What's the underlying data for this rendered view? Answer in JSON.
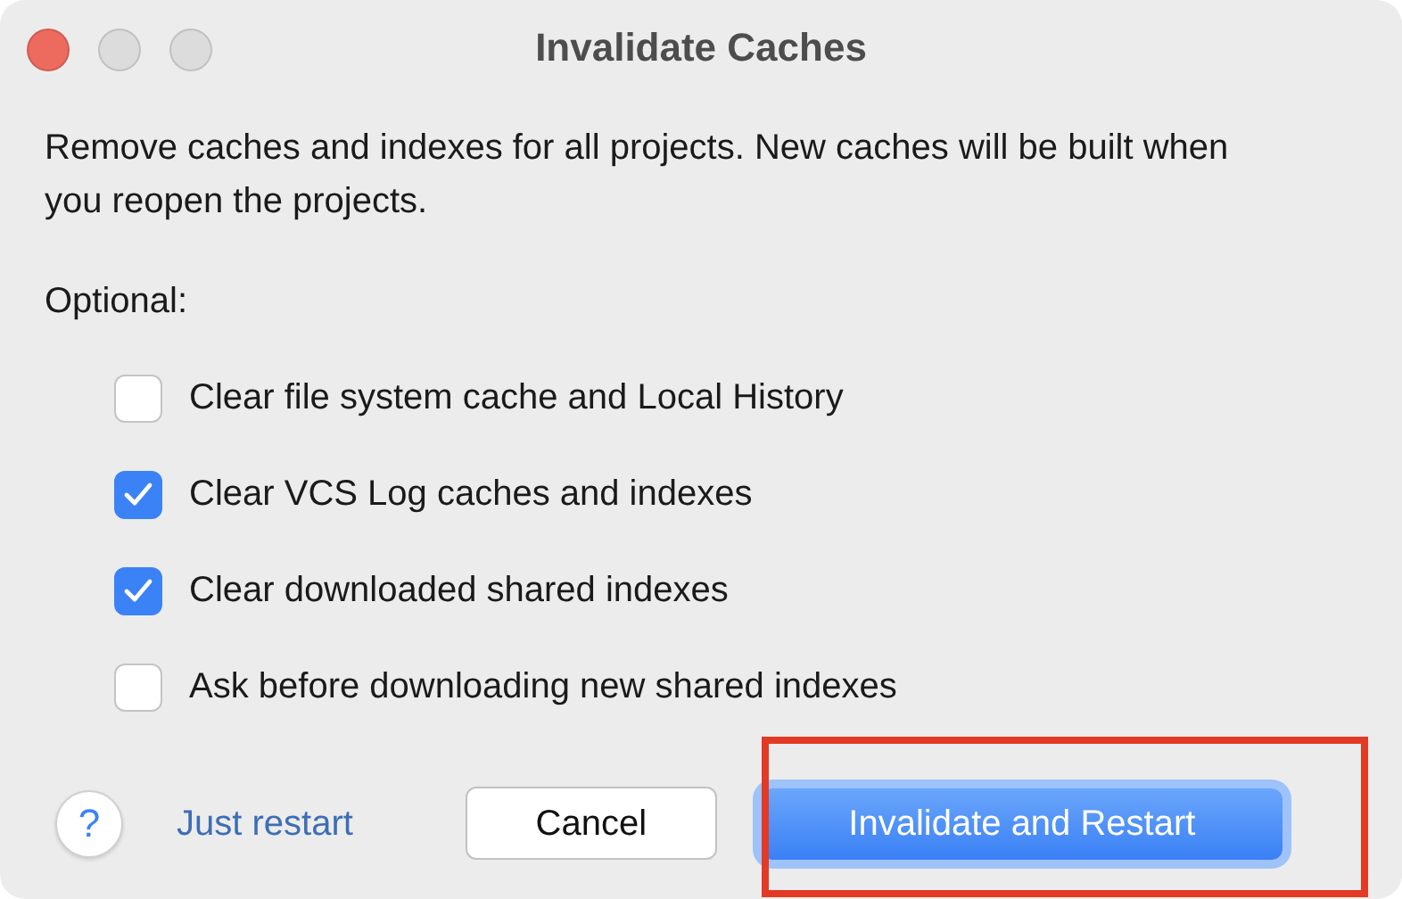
{
  "window": {
    "title": "Invalidate Caches",
    "controls": [
      {
        "color": "#ed6a5e"
      },
      {
        "color": "#dcdcdc"
      },
      {
        "color": "#dcdcdc"
      }
    ]
  },
  "description": "Remove caches and indexes for all projects. New caches will be built when you reopen the projects.",
  "optional_label": "Optional:",
  "options": [
    {
      "label": "Clear file system cache and Local History",
      "checked": false
    },
    {
      "label": "Clear VCS Log caches and indexes",
      "checked": true
    },
    {
      "label": "Clear downloaded shared indexes",
      "checked": true
    },
    {
      "label": "Ask before downloading new shared indexes",
      "checked": false
    }
  ],
  "help_button": {
    "label": "?"
  },
  "link": "Just restart",
  "cancel_button": {
    "label": "Cancel"
  },
  "primary_button": {
    "label": "Invalidate and Restart",
    "highlighted": true
  }
}
